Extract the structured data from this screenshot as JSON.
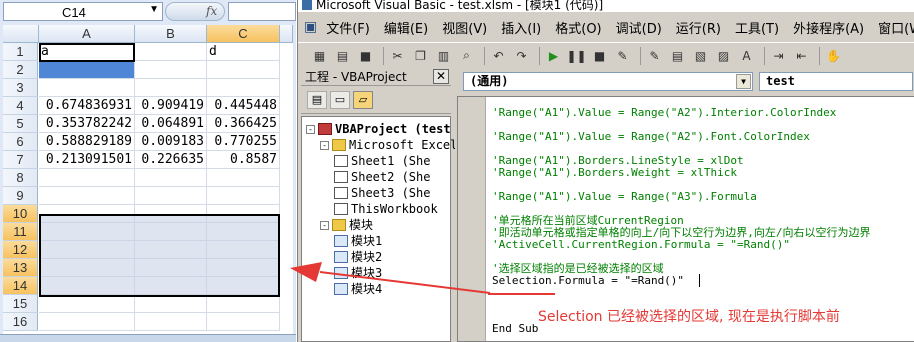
{
  "excel": {
    "name_box": "C14",
    "fx_label": "fx",
    "columns": [
      "A",
      "B",
      "C"
    ],
    "rows": [
      "1",
      "2",
      "3",
      "4",
      "5",
      "6",
      "7",
      "8",
      "9",
      "10",
      "11",
      "12",
      "13",
      "14",
      "15",
      "16"
    ],
    "cells": {
      "A1": "a",
      "C1": "d",
      "A4": "0.674836931",
      "B4": "0.909419",
      "C4": "0.445448",
      "A5": "0.353782242",
      "B5": "0.064891",
      "C5": "0.366425",
      "A6": "0.588829189",
      "B6": "0.009183",
      "C6": "0.770255",
      "A7": "0.213091501",
      "B7": "0.226635",
      "C7": "0.8587"
    }
  },
  "vbe": {
    "title": "Microsoft Visual Basic - test.xlsm - [模块1 (代码)]",
    "menu": [
      "文件(F)",
      "编辑(E)",
      "视图(V)",
      "插入(I)",
      "格式(O)",
      "调试(D)",
      "运行(R)",
      "工具(T)",
      "外接程序(A)",
      "窗口(W)"
    ],
    "project_panel_title": "工程 - VBAProject",
    "tree": [
      {
        "label": "VBAProject (test",
        "indent": 0,
        "toggle": "-",
        "icon": "proj",
        "bold": true
      },
      {
        "label": "Microsoft Excel",
        "indent": 1,
        "toggle": "-",
        "icon": "folder"
      },
      {
        "label": "Sheet1 (She",
        "indent": 2,
        "toggle": "",
        "icon": "sheet"
      },
      {
        "label": "Sheet2 (She",
        "indent": 2,
        "toggle": "",
        "icon": "sheet"
      },
      {
        "label": "Sheet3 (She",
        "indent": 2,
        "toggle": "",
        "icon": "sheet"
      },
      {
        "label": "ThisWorkbook",
        "indent": 2,
        "toggle": "",
        "icon": "sheet"
      },
      {
        "label": "模块",
        "indent": 1,
        "toggle": "-",
        "icon": "folder"
      },
      {
        "label": "模块1",
        "indent": 2,
        "toggle": "",
        "icon": "module"
      },
      {
        "label": "模块2",
        "indent": 2,
        "toggle": "",
        "icon": "module"
      },
      {
        "label": "模块3",
        "indent": 2,
        "toggle": "",
        "icon": "module"
      },
      {
        "label": "模块4",
        "indent": 2,
        "toggle": "",
        "icon": "module"
      }
    ],
    "object_combo": "(通用)",
    "procedure_combo": "test",
    "code_lines": [
      {
        "text": "'Range(\"A1\").Value = Range(\"A2\").Interior.ColorIndex",
        "kind": "comment"
      },
      {
        "text": "",
        "kind": "code"
      },
      {
        "text": "'Range(\"A1\").Value = Range(\"A2\").Font.ColorIndex",
        "kind": "comment"
      },
      {
        "text": "",
        "kind": "code"
      },
      {
        "text": "'Range(\"A1\").Borders.LineStyle = xlDot",
        "kind": "comment"
      },
      {
        "text": "'Range(\"A1\").Borders.Weight = xlThick",
        "kind": "comment"
      },
      {
        "text": "",
        "kind": "code"
      },
      {
        "text": "'Range(\"A1\").Value = Range(\"A3\").Formula",
        "kind": "comment"
      },
      {
        "text": "",
        "kind": "code"
      },
      {
        "text": "'单元格所在当前区域CurrentRegion",
        "kind": "comment"
      },
      {
        "text": "'即活动单元格或指定单格的向上/向下以空行为边界,向左/向右以空行为边界",
        "kind": "comment"
      },
      {
        "text": "'ActiveCell.CurrentRegion.Formula = \"=Rand()\"",
        "kind": "comment"
      },
      {
        "text": "",
        "kind": "code"
      },
      {
        "text": "'选择区域指的是已经被选择的区域",
        "kind": "comment"
      },
      {
        "text": "Selection.Formula = \"=Rand()\"",
        "kind": "code"
      },
      {
        "text": "",
        "kind": "code"
      },
      {
        "text": "",
        "kind": "code"
      },
      {
        "text": "",
        "kind": "code"
      },
      {
        "text": "End Sub",
        "kind": "code"
      }
    ],
    "annotation": "Selection 已经被选择的区域, 现在是执行脚本前"
  },
  "colors": {
    "comment": "#008000",
    "annotation": "#e53935",
    "selection_fill": "#c4d0e4",
    "cell_highlight": "#4f86d6"
  }
}
